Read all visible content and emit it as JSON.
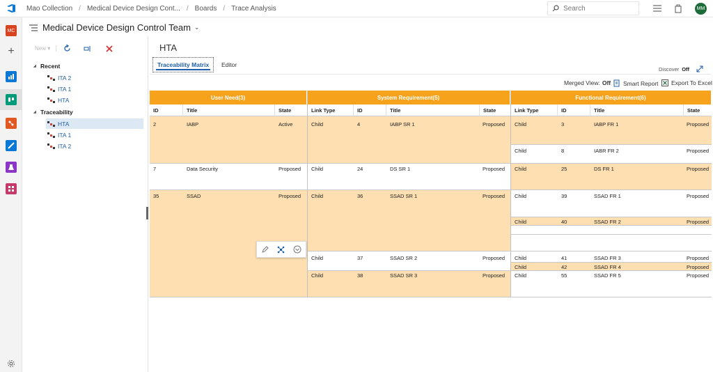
{
  "breadcrumbs": [
    "Mao Collection",
    "Medical Device Design Cont...",
    "Boards",
    "Trace Analysis"
  ],
  "search": {
    "placeholder": "Search"
  },
  "user": {
    "initials": "MM",
    "org_initials": "MC"
  },
  "team": {
    "name": "Medical Device Design Control Team"
  },
  "toolbar": {
    "new_label": "New"
  },
  "tree": {
    "recent_label": "Recent",
    "recent": [
      "ITA 2",
      "ITA 1",
      "HTA"
    ],
    "traceability_label": "Traceability",
    "traceability": [
      "HTA",
      "ITA 1",
      "ITA 2"
    ]
  },
  "main": {
    "title": "HTA",
    "tabs": [
      "Traceability Matrix",
      "Editor"
    ],
    "discover_label": "Discover",
    "discover_value": "Off",
    "merged_label": "Merged View:",
    "merged_value": "Off",
    "smart_report": "Smart Report",
    "export_excel": "Export To Excel"
  },
  "matrix": {
    "groups": [
      "User Need(3)",
      "System Requirement(5)",
      "Functional Requirement(6)"
    ],
    "user_cols": [
      "ID",
      "Title",
      "State"
    ],
    "sys_cols": [
      "Link Type",
      "ID",
      "Title",
      "State"
    ],
    "func_cols": [
      "Link Type",
      "ID",
      "Title",
      "State"
    ],
    "user_needs": [
      {
        "id": "2",
        "title": "IABP",
        "state": "Active"
      },
      {
        "id": "7",
        "title": "Data Security",
        "state": "Proposed"
      },
      {
        "id": "35",
        "title": "SSAD",
        "state": "Proposed"
      }
    ],
    "system_reqs": [
      {
        "link": "Child",
        "id": "4",
        "title": "IABP SR 1",
        "state": "Proposed"
      },
      {
        "link": "Child",
        "id": "24",
        "title": "DS SR 1",
        "state": "Proposed"
      },
      {
        "link": "Child",
        "id": "36",
        "title": "SSAD SR 1",
        "state": "Proposed"
      },
      {
        "link": "Child",
        "id": "37",
        "title": "SSAD SR 2",
        "state": "Proposed"
      },
      {
        "link": "Child",
        "id": "38",
        "title": "SSAD SR 3",
        "state": "Proposed"
      }
    ],
    "functional_reqs": [
      {
        "link": "Child",
        "id": "3",
        "title": "IABP FR 1",
        "state": "Proposed"
      },
      {
        "link": "Child",
        "id": "8",
        "title": "IABR FR 2",
        "state": "Proposed"
      },
      {
        "link": "Child",
        "id": "25",
        "title": "DS FR 1",
        "state": "Proposed"
      },
      {
        "link": "Child",
        "id": "39",
        "title": "SSAD FR 1",
        "state": "Proposed"
      },
      {
        "link": "Child",
        "id": "40",
        "title": "SSAD FR 2",
        "state": "Proposed"
      },
      {
        "link": "Child",
        "id": "41",
        "title": "SSAD FR 3",
        "state": "Proposed"
      },
      {
        "link": "Child",
        "id": "42",
        "title": "SSAD FR 4",
        "state": "Proposed"
      },
      {
        "link": "Child",
        "id": "55",
        "title": "SSAD FR 5",
        "state": "Proposed"
      }
    ]
  },
  "colors": {
    "accent": "#f7a21b",
    "row_highlight": "#fddfb1",
    "link": "#1f5ea8"
  }
}
